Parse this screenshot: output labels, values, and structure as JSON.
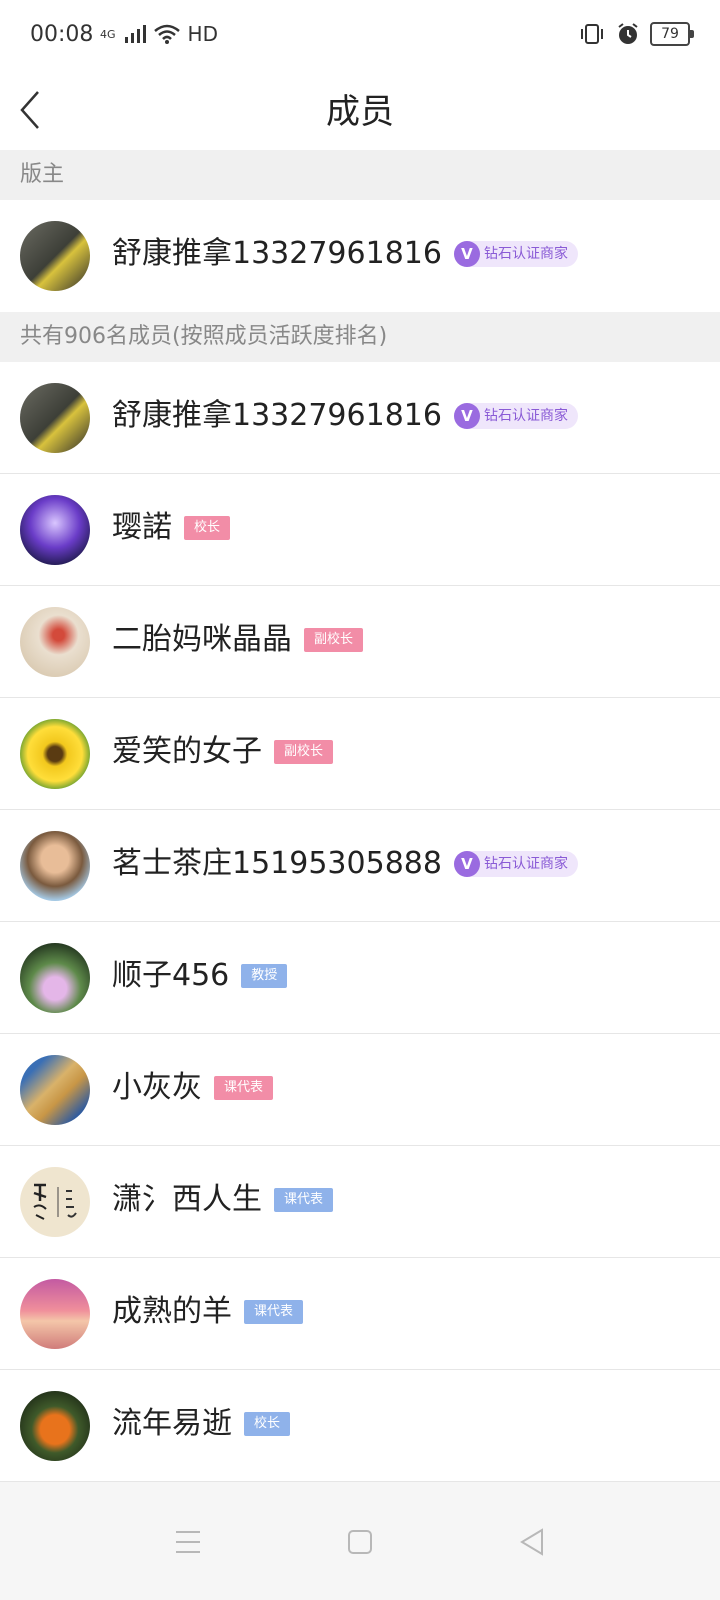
{
  "status_bar": {
    "time": "00:08",
    "network": "4G",
    "hd": "HD",
    "battery": "79"
  },
  "header": {
    "title": "成员"
  },
  "owner_section": {
    "label": "版主"
  },
  "owner": {
    "name": "舒康推拿13327961816",
    "badge": "钻石认证商家"
  },
  "members_section": {
    "label": "共有906名成员(按照成员活跃度排名)"
  },
  "members": [
    {
      "name": "舒康推拿13327961816",
      "badge": "钻石认证商家",
      "badge_type": "verified"
    },
    {
      "name": "璎諾",
      "badge": "校长",
      "badge_type": "pink"
    },
    {
      "name": "二胎妈咪晶晶",
      "badge": "副校长",
      "badge_type": "pink"
    },
    {
      "name": "爱笑的女子",
      "badge": "副校长",
      "badge_type": "pink"
    },
    {
      "name": "茗士茶庄15195305888",
      "badge": "钻石认证商家",
      "badge_type": "verified"
    },
    {
      "name": "顺子456",
      "badge": "教授",
      "badge_type": "blue"
    },
    {
      "name": "小灰灰",
      "badge": "课代表",
      "badge_type": "pink"
    },
    {
      "name": "潇氵西人生",
      "badge": "课代表",
      "badge_type": "blue"
    },
    {
      "name": "成熟的羊",
      "badge": "课代表",
      "badge_type": "blue"
    },
    {
      "name": "流年易逝",
      "badge": "校长",
      "badge_type": "blue"
    }
  ],
  "colors": {
    "pink_badge": "#f28da7",
    "blue_badge": "#8fb2ea",
    "verified_badge": "#9a6be0"
  }
}
